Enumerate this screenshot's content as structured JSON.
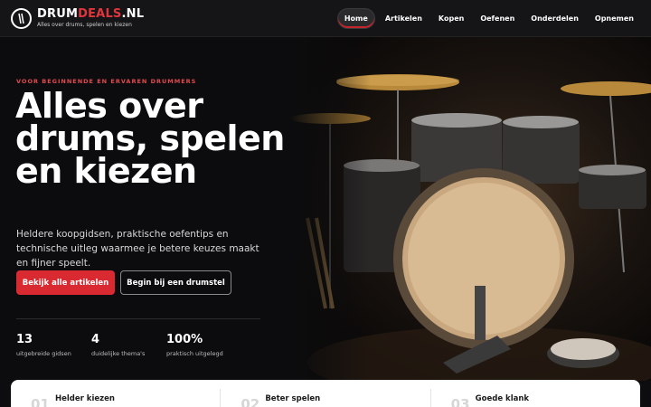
{
  "brand": {
    "name_part1": "DRUM",
    "name_part2": "DEALS",
    "name_part3": ".NL",
    "tagline": "Alles over drums, spelen en kiezen"
  },
  "nav": {
    "items": [
      {
        "label": "Home",
        "active": true
      },
      {
        "label": "Artikelen",
        "active": false
      },
      {
        "label": "Kopen",
        "active": false
      },
      {
        "label": "Oefenen",
        "active": false
      },
      {
        "label": "Onderdelen",
        "active": false
      },
      {
        "label": "Opnemen",
        "active": false
      }
    ]
  },
  "hero": {
    "eyebrow": "VOOR BEGINNENDE EN ERVAREN DRUMMERS",
    "title": "Alles over drums, spelen en kiezen",
    "lead": "Heldere koopgidsen, praktische oefentips en technische uitleg waarmee je betere keuzes maakt en fijner speelt.",
    "primary_cta": "Bekijk alle artikelen",
    "secondary_cta": "Begin bij een drumstel",
    "stats": [
      {
        "value": "13",
        "label": "uitgebreide gidsen"
      },
      {
        "value": "4",
        "label": "duidelijke thema's"
      },
      {
        "value": "100%",
        "label": "praktisch uitgelegd"
      }
    ]
  },
  "cards": [
    {
      "num": "01",
      "title": "Helder kiezen"
    },
    {
      "num": "02",
      "title": "Beter spelen"
    },
    {
      "num": "03",
      "title": "Goede klank"
    }
  ],
  "colors": {
    "accent": "#d92a31",
    "background": "#0c0c0e"
  }
}
